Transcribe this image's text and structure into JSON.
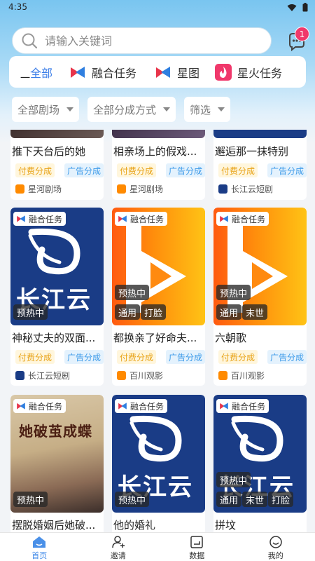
{
  "status_bar": {
    "time": "4:35"
  },
  "search": {
    "placeholder": "请输入关键词"
  },
  "messages": {
    "badge": "1"
  },
  "tabs": {
    "dash": "一",
    "items": [
      {
        "label": "全部",
        "active": true
      },
      {
        "label": "融合任务"
      },
      {
        "label": "星图"
      },
      {
        "label": "星火任务"
      }
    ]
  },
  "filters": [
    "全部剧场",
    "全部分成方式",
    "筛选"
  ],
  "share_labels": {
    "pay": "付费分成",
    "ad": "广告分成"
  },
  "cards": [
    {
      "title": "推下天台后的她",
      "platform": "星河剧场"
    },
    {
      "title": "相亲场上的假戏...",
      "platform": "星河剧场"
    },
    {
      "title": "邂逅那一抹特别",
      "platform": "长江云短剧"
    },
    {
      "title": "神秘丈夫的双面...",
      "platform": "长江云短剧",
      "task": "融合任务",
      "poster_text": "长江云",
      "chips": [
        "预热中"
      ]
    },
    {
      "title": "都换亲了好命夫...",
      "platform": "百川观影",
      "task": "融合任务",
      "chips": [
        "预热中",
        "通用",
        "打脸"
      ]
    },
    {
      "title": "六朝歌",
      "platform": "百川观影",
      "task": "融合任务",
      "chips": [
        "预热中",
        "通用",
        "末世"
      ]
    },
    {
      "title": "摆脱婚姻后她破...",
      "task": "融合任务",
      "poster_text": "她破茧成蝶",
      "chips": [
        "预热中"
      ]
    },
    {
      "title": "他的婚礼",
      "task": "融合任务",
      "poster_text": "长江云",
      "chips": [
        "预热中"
      ]
    },
    {
      "title": "拼坟",
      "task": "融合任务",
      "poster_text": "长江云",
      "chips": [
        "预热中",
        "通用",
        "末世",
        "打脸"
      ]
    }
  ],
  "bottom_nav": [
    {
      "label": "首页",
      "active": true
    },
    {
      "label": "邀请"
    },
    {
      "label": "数据"
    },
    {
      "label": "我的"
    }
  ],
  "colors": {
    "accent": "#3a7de8",
    "badge": "#f0386b",
    "pay": "#e8a317",
    "ad": "#3d9be9",
    "poster_blue": "#1a3c86"
  }
}
